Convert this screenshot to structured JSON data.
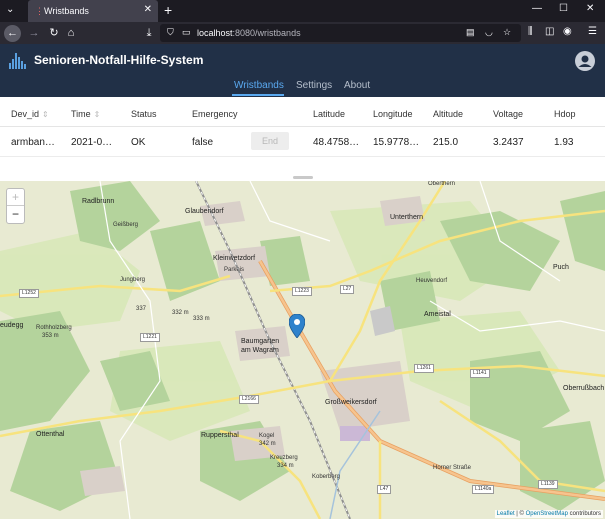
{
  "browser": {
    "tab_title": "Wristbands",
    "tab_favicon": "dots-icon",
    "url_host": "localhost",
    "url_path": ":8080/wristbands",
    "new_tab": "+",
    "minimize": "—",
    "maximize": "☐",
    "close": "✕"
  },
  "app": {
    "brand": "Senioren-Notfall-Hilfe-System",
    "brand_color": "#213047",
    "accent": "#5aa9f0",
    "nav": [
      {
        "label": "Wristbands",
        "active": true
      },
      {
        "label": "Settings",
        "active": false
      },
      {
        "label": "About",
        "active": false
      }
    ]
  },
  "table": {
    "headers": [
      "Dev_id",
      "Time",
      "Status",
      "Emergency",
      "Latitude",
      "Longitude",
      "Altitude",
      "Voltage",
      "Hdop"
    ],
    "row": {
      "dev_id": "armban…",
      "time": "2021-0…",
      "status": "OK",
      "emergency": "false",
      "end_button": "End",
      "latitude": "48.4758…",
      "longitude": "15.9778…",
      "altitude": "215.0",
      "voltage": "3.2437",
      "hdop": "1.93"
    }
  },
  "map": {
    "zoom_in": "+",
    "zoom_out": "−",
    "attribution_leaflet": "Leaflet",
    "attribution_sep": " | © ",
    "attribution_osm": "OpenStreetMap",
    "attribution_tail": " contributors",
    "places": {
      "radlbrunn": "Radlbrunn",
      "glaubendorf": "Glaubendorf",
      "unterthern": "Unterthern",
      "oberthern": "Oberthern",
      "geissberg": "Geißberg",
      "jungberg": "Jungberg",
      "kleinwetzdorf": "Kleinwetzdorf",
      "parkeis": "Parkeis",
      "puch": "Puch",
      "rothholzberg": "Rothholzberg",
      "rothholzberg_h": "353 m",
      "heuvendorf": "Heuvendorf",
      "ameistal": "Ameistal",
      "baumgarten": "Baumgarten",
      "am_wagram": "am Wagram",
      "grossweikersdorf": "Großweikersdorf",
      "oberrusbach": "Oberrußbach",
      "ottenthal": "Ottenthal",
      "ruppersthal": "Ruppersthal",
      "kogel": "Kogel",
      "kogel_h": "342 m",
      "kreuzberg": "Kreuzberg",
      "kreuzberg_h": "334 m",
      "koberberg": "Koberberg",
      "neudegg": "eudegg",
      "elev_337": "337",
      "elev_332": "332 m",
      "elev_333": "333 m",
      "horner_strasse": "Horner Straße"
    },
    "roads": {
      "l1252": "L1252",
      "l1223": "L1223",
      "l27": "L27",
      "l1221": "L1221",
      "l1261": "L1261",
      "l1141": "L1141",
      "l2166": "L2166",
      "l47": "L47",
      "l1140a": "L1140a",
      "l1139": "L1139"
    }
  }
}
